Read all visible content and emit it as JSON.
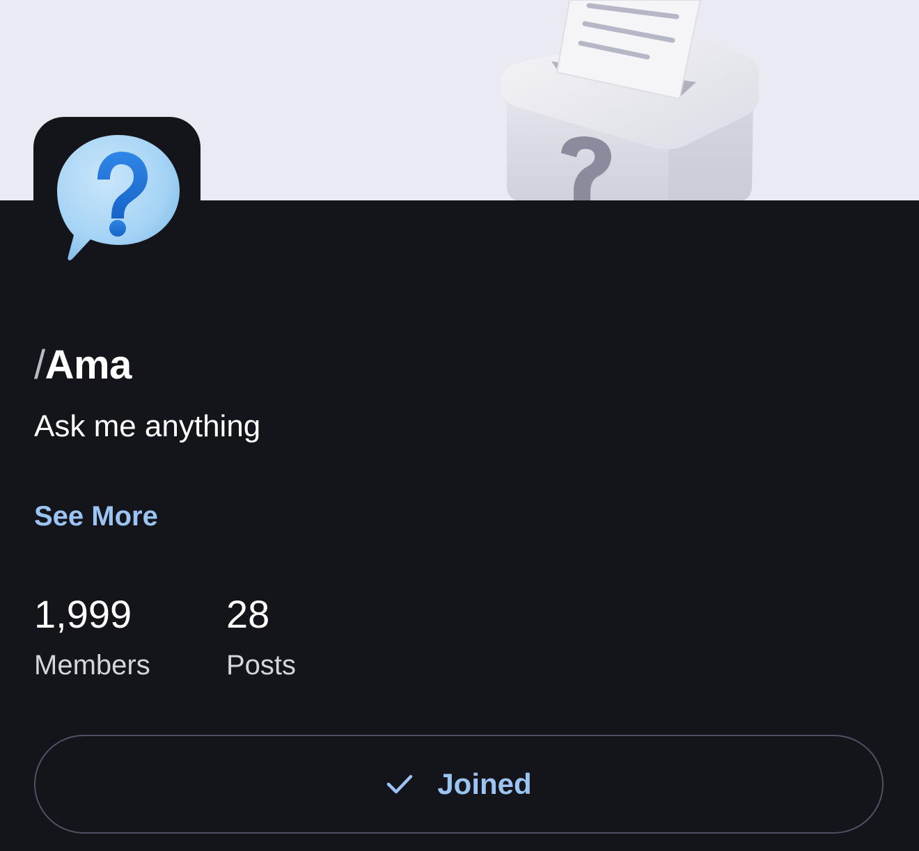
{
  "banner": {
    "image_icon": "ballot-box-question-icon"
  },
  "avatar": {
    "icon": "question-bubble-icon"
  },
  "community": {
    "slash": "/",
    "name": "Ama",
    "description": "Ask me anything",
    "see_more_label": "See More"
  },
  "stats": {
    "members": {
      "value": "1,999",
      "label": "Members"
    },
    "posts": {
      "value": "28",
      "label": "Posts"
    }
  },
  "join_button": {
    "label": "Joined",
    "icon": "check-icon"
  },
  "colors": {
    "background": "#14141b",
    "banner": "#eaebf2",
    "accent": "#9cc4f2",
    "text": "#ffffff",
    "muted_text": "#d4d5dd",
    "button_border": "#4f5064"
  }
}
